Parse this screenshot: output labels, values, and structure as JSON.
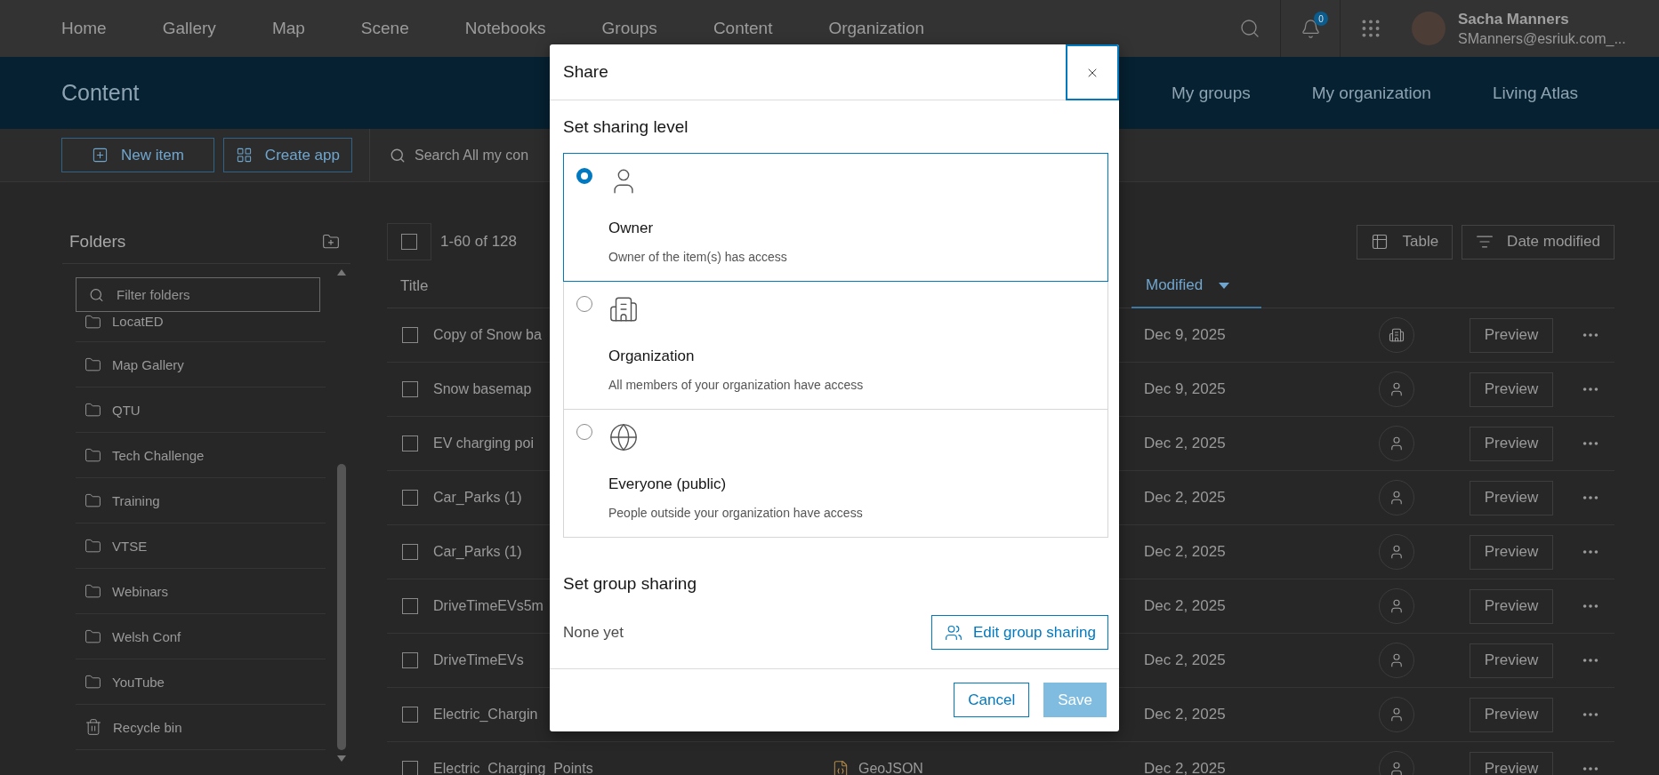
{
  "nav": {
    "items": [
      "Home",
      "Gallery",
      "Map",
      "Scene",
      "Notebooks",
      "Groups",
      "Content",
      "Organization"
    ],
    "notifications_count": "0",
    "user": {
      "name": "Sacha Manners",
      "email": "SManners@esriuk.com_..."
    }
  },
  "header": {
    "title": "Content",
    "tabs": [
      "My groups",
      "My organization",
      "Living Atlas"
    ]
  },
  "toolbar": {
    "buttons": [
      {
        "kind": "new",
        "label": "New item"
      },
      {
        "kind": "app",
        "label": "Create app"
      }
    ],
    "search": {
      "placeholder": "Search All my con"
    }
  },
  "folders": {
    "title": "Folders",
    "filter_placeholder": "Filter folders",
    "items": [
      {
        "kind": "folder",
        "label": "LocatED"
      },
      {
        "kind": "folder",
        "label": "Map Gallery"
      },
      {
        "kind": "folder",
        "label": "QTU"
      },
      {
        "kind": "folder",
        "label": "Tech Challenge"
      },
      {
        "kind": "folder",
        "label": "Training"
      },
      {
        "kind": "folder",
        "label": "VTSE"
      },
      {
        "kind": "folder",
        "label": "Webinars"
      },
      {
        "kind": "folder",
        "label": "Welsh Conf"
      },
      {
        "kind": "folder",
        "label": "YouTube"
      },
      {
        "kind": "recycle",
        "label": "Recycle bin"
      }
    ]
  },
  "table": {
    "select_all_checked": false,
    "count": "1-60 of 128",
    "view_button": "Table",
    "sort_button": "Date modified",
    "columns": [
      "Title",
      "Modified"
    ],
    "rows": [
      {
        "checked": false,
        "title": "Copy of Snow ba",
        "modified": "Dec 9, 2025",
        "kind": "organization",
        "action": "Preview"
      },
      {
        "checked": false,
        "title": "Snow basemap",
        "modified": "Dec 9, 2025",
        "kind": "owner",
        "action": "Preview"
      },
      {
        "checked": false,
        "title": "EV charging poi",
        "modified": "Dec 2, 2025",
        "kind": "owner",
        "action": "Preview"
      },
      {
        "checked": false,
        "title": "Car_Parks (1)",
        "modified": "Dec 2, 2025",
        "kind": "owner",
        "action": "Preview"
      },
      {
        "checked": false,
        "title": "Car_Parks (1)",
        "modified": "Dec 2, 2025",
        "kind": "owner",
        "action": "Preview"
      },
      {
        "checked": false,
        "title": "DriveTimeEVs5m",
        "modified": "Dec 2, 2025",
        "kind": "owner",
        "action": "Preview"
      },
      {
        "checked": false,
        "title": "DriveTimeEVs",
        "modified": "Dec 2, 2025",
        "kind": "owner",
        "action": "Preview"
      },
      {
        "checked": false,
        "title": "Electric_Chargin",
        "modified": "Dec 2, 2025",
        "kind": "owner",
        "action": "Preview"
      },
      {
        "checked": false,
        "title": "Electric_Charging_Points",
        "type": "GeoJSON",
        "modified": "Dec 2, 2025",
        "kind": "owner",
        "action": "Preview"
      }
    ]
  },
  "dialog": {
    "title": "Share",
    "level_heading": "Set sharing level",
    "options": [
      {
        "kind": "owner",
        "label": "Owner",
        "description": "Owner of the item(s) has access",
        "selected": true
      },
      {
        "kind": "organization",
        "label": "Organization",
        "description": "All members of your organization have access",
        "selected": false
      },
      {
        "kind": "public",
        "label": "Everyone (public)",
        "description": "People outside your organization have access",
        "selected": false
      }
    ],
    "group_heading": "Set group sharing",
    "group_value": "None yet",
    "edit_button": "Edit group sharing",
    "cancel": "Cancel",
    "save": {
      "label": "Save",
      "disabled": true
    }
  }
}
